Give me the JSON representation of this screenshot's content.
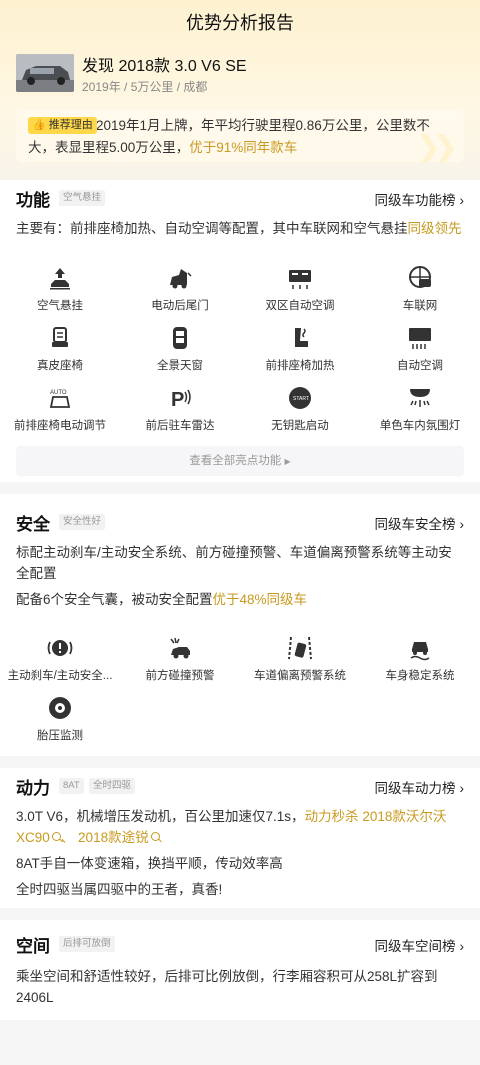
{
  "page_title": "优势分析报告",
  "car": {
    "name": "发现 2018款 3.0 V6 SE",
    "meta": "2019年 / 5万公里 / 成都"
  },
  "recommend": {
    "tag": "推荐理由",
    "text_main": "2019年1月上牌，年平均行驶里程0.86万公里，公里数不大，表显里程5.00万公里，",
    "text_highlight": "优于91%同年款车"
  },
  "function": {
    "title": "功能",
    "badge": "空气悬挂",
    "rank_label": "同级车功能榜",
    "desc_main": "主要有：前排座椅加热、自动空调等配置，其中车联网和空气悬挂",
    "desc_highlight": "同级领先",
    "items": [
      {
        "label": "空气悬挂",
        "icon": "air-suspension-icon"
      },
      {
        "label": "电动后尾门",
        "icon": "power-tailgate-icon"
      },
      {
        "label": "双区自动空调",
        "icon": "dual-zone-ac-icon"
      },
      {
        "label": "车联网",
        "icon": "connected-car-icon"
      },
      {
        "label": "真皮座椅",
        "icon": "leather-seat-icon"
      },
      {
        "label": "全景天窗",
        "icon": "panoramic-sunroof-icon"
      },
      {
        "label": "前排座椅加热",
        "icon": "seat-heating-icon"
      },
      {
        "label": "自动空调",
        "icon": "auto-ac-icon"
      },
      {
        "label": "前排座椅电动调节",
        "icon": "power-seat-icon"
      },
      {
        "label": "前后驻车雷达",
        "icon": "parking-radar-icon"
      },
      {
        "label": "无钥匙启动",
        "icon": "keyless-start-icon"
      },
      {
        "label": "单色车内氛围灯",
        "icon": "ambient-light-icon"
      }
    ],
    "more_label": "查看全部亮点功能"
  },
  "safety": {
    "title": "安全",
    "badge": "安全性好",
    "rank_label": "同级车安全榜",
    "desc1": "标配主动刹车/主动安全系统、前方碰撞预警、车道偏离预警系统等主动安全配置",
    "desc2_main": "配备6个安全气囊，被动安全配置",
    "desc2_highlight": "优于48%同级车",
    "items": [
      {
        "label": "主动刹车/主动安全...",
        "icon": "active-brake-icon"
      },
      {
        "label": "前方碰撞预警",
        "icon": "collision-warning-icon"
      },
      {
        "label": "车道偏离预警系统",
        "icon": "lane-departure-icon"
      },
      {
        "label": "车身稳定系统",
        "icon": "stability-control-icon"
      },
      {
        "label": "胎压监测",
        "icon": "tire-pressure-icon"
      }
    ]
  },
  "power": {
    "title": "动力",
    "badges": [
      "8AT",
      "全时四驱"
    ],
    "rank_label": "同级车动力榜",
    "line1_main": "3.0T V6，机械增压发动机，百公里加速仅7.1s，",
    "line1_highlight": "动力秒杀",
    "compare1": "2018款沃尔沃XC90",
    "sep": "、",
    "compare2": "2018款途锐",
    "line2": "8AT手自一体变速箱，换挡平顺，传动效率高",
    "line3": "全时四驱当属四驱中的王者，真香!"
  },
  "space": {
    "title": "空间",
    "badge": "后排可放倒",
    "rank_label": "同级车空间榜",
    "desc": "乘坐空间和舒适性较好，后排可比例放倒，行李厢容积可从258L扩容到2406L"
  },
  "colors": {
    "highlight": "#c89a20",
    "tag_bg": "#ffd84a",
    "header_bg": "#fdf1cf"
  }
}
